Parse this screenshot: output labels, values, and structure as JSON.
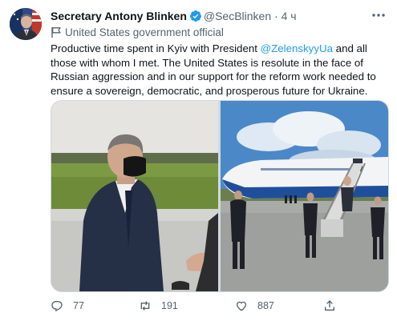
{
  "tweet": {
    "author": {
      "name": "Secretary Antony Blinken",
      "handle": "@SecBlinken",
      "separator": "·",
      "time": "4 ч",
      "verified": true
    },
    "label": "United States government official",
    "text": {
      "part1": "Productive time spent in Kyiv with President ",
      "mention": "@ZelenskyyUa",
      "part2": " and all those with whom I met. The United States is resolute in the face of Russian aggression and in our support for the reform work needed to ensure a sovereign, democratic, and prosperous future for Ukraine."
    },
    "actions": {
      "replies": "77",
      "retweets": "191",
      "likes": "887"
    }
  },
  "colors": {
    "accent": "#1d9bf0",
    "secondary_text": "#536471",
    "border": "#cfd9de"
  },
  "icons": [
    "more-icon",
    "verified-icon",
    "government-flag-icon",
    "reply-icon",
    "retweet-icon",
    "like-icon",
    "share-icon"
  ]
}
